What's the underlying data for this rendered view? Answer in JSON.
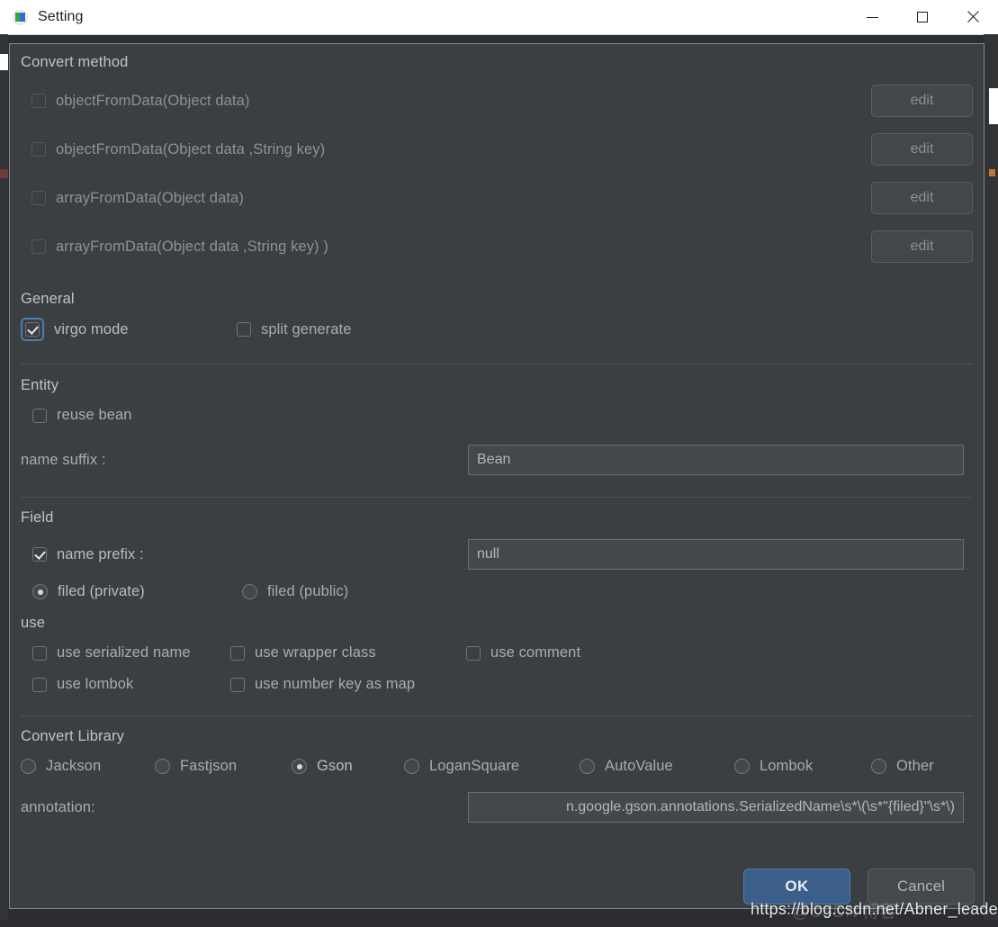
{
  "window": {
    "title": "Setting",
    "icon": "app-icon",
    "controls": {
      "minimize": "minimize-icon",
      "maximize": "maximize-icon",
      "close": "close-icon"
    }
  },
  "convert_method": {
    "title": "Convert method",
    "items": [
      {
        "label": "objectFromData(Object data)",
        "checked": false,
        "enabled": false,
        "button": "edit"
      },
      {
        "label": "objectFromData(Object data ,String key)",
        "checked": false,
        "enabled": false,
        "button": "edit"
      },
      {
        "label": "arrayFromData(Object data)",
        "checked": false,
        "enabled": false,
        "button": "edit"
      },
      {
        "label": "arrayFromData(Object data ,String key) )",
        "checked": false,
        "enabled": false,
        "button": "edit"
      }
    ]
  },
  "general": {
    "title": "General",
    "items": [
      {
        "label": "virgo mode",
        "checked": true,
        "focused": true
      },
      {
        "label": "split generate",
        "checked": false,
        "focused": false
      }
    ]
  },
  "entity": {
    "title": "Entity",
    "reuse_bean": {
      "label": "reuse bean",
      "checked": false
    },
    "name_suffix": {
      "label": "name suffix :",
      "value": "Bean"
    }
  },
  "field": {
    "title": "Field",
    "name_prefix": {
      "label": "name prefix :",
      "checked": true,
      "value": "null"
    },
    "visibility": {
      "options": [
        {
          "label": "filed (private)",
          "selected": true
        },
        {
          "label": "filed (public)",
          "selected": false
        }
      ]
    }
  },
  "use": {
    "title": "use",
    "row1": [
      {
        "label": "use serialized name",
        "checked": false
      },
      {
        "label": "use wrapper class",
        "checked": false
      },
      {
        "label": "use comment",
        "checked": false
      }
    ],
    "row2": [
      {
        "label": "use lombok",
        "checked": false
      },
      {
        "label": "use number key as map",
        "checked": false
      }
    ]
  },
  "convert_library": {
    "title": "Convert Library",
    "options": [
      {
        "label": "Jackson",
        "selected": false
      },
      {
        "label": "Fastjson",
        "selected": false
      },
      {
        "label": "Gson",
        "selected": true
      },
      {
        "label": "LoganSquare",
        "selected": false
      },
      {
        "label": "AutoValue",
        "selected": false
      },
      {
        "label": "Lombok",
        "selected": false
      },
      {
        "label": "Other",
        "selected": false
      }
    ],
    "annotation": {
      "label": "annotation:",
      "value": "n.google.gson.annotations.SerializedName\\s*\\(\\s*\"{filed}\"\\s*\\)"
    }
  },
  "buttons": {
    "ok": "OK",
    "cancel": "Cancel"
  },
  "watermark": {
    "url": "https://blog.csdn.net/Abner_leader",
    "faint": "@CSDN 博客"
  },
  "colors": {
    "panel_bg": "#3c3f41",
    "panel_border": "#7a8a99",
    "titlebar_bg": "#ffffff",
    "accent_blue": "#3c5f8a",
    "focus_blue": "#4b7bb5",
    "text": "#a9acaf",
    "text_dim": "#8e9295",
    "field_bg": "#45484a"
  }
}
